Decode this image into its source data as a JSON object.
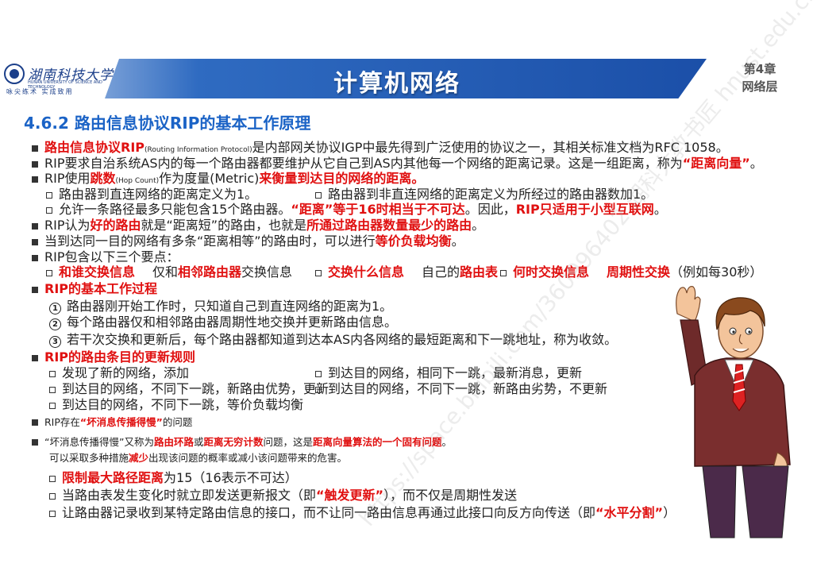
{
  "header": {
    "school_name": "湖南科技大学",
    "school_sub": "HUNAN UNIVERSITY OF SCIENCE AND TECHNOLOGY",
    "motto": "咏尖练术 实成致用",
    "title": "计算机网络",
    "chapter_line1": "第4章",
    "chapter_line2": "网络层"
  },
  "section_title": "4.6.2 路由信息协议RIP的基本工作原理",
  "lines": {
    "l1a": "路由信息协议RIP",
    "l1b": "(Routing Information Protocol)",
    "l1c": "是内部网关协议IGP中最先得到广泛使用的协议之一，其相关标准文档为RFC 1058。",
    "l2a": "RIP要求自治系统AS内的每一个路由器都要维护从它自己到AS内其他每一个网络的距离记录。这是一组距离，称为",
    "l2b": "“距离向量”",
    "l2c": "。",
    "l3a": "RIP使用",
    "l3b": "跳数",
    "l3c": "(Hop Count)",
    "l3d": "作为度量(Metric)",
    "l3e": "来衡量到达目的网络的距离。",
    "l4a": "路由器到直连网络的距离定义为1。",
    "l4b": "路由器到非直连网络的距离定义为所经过的路由器数加1。",
    "l5a": "允许一条路径最多只能包含15个路由器。",
    "l5b": "“距离”等于16时相当于不可达",
    "l5c": "。因此，",
    "l5d": "RIP只适用于小型互联网",
    "l5e": "。",
    "l6a": "RIP认为",
    "l6b": "好的路由",
    "l6c": "就是“距离短”的路由，也就是",
    "l6d": "所通过路由器数量最少的路由",
    "l6e": "。",
    "l7a": "当到达同一目的网络有多条“距离相等”的路由时，可以进行",
    "l7b": "等价负载均衡",
    "l7c": "。",
    "l8": "RIP包含以下三个要点：",
    "l9a": "和谁交换信息",
    "l9b": "仅和",
    "l9c": "相邻路由器",
    "l9d": "交换信息",
    "l9e": "交换什么信息",
    "l9f": "自己的",
    "l9g": "路由表",
    "l9h": "何时交换信息",
    "l9i": "周期性交换",
    "l9j": "（例如每30秒）",
    "l10": "RIP的基本工作过程",
    "n1": "1",
    "n2": "2",
    "n3": "3",
    "s1": "路由器刚开始工作时，只知道自己到直连网络的距离为1。",
    "s2": "每个路由器仅和相邻路由器周期性地交换并更新路由信息。",
    "s3": "若干次交换和更新后，每个路由器都知道到达本AS内各网络的最短距离和下一跳地址，称为收敛。",
    "l11": "RIP的路由条目的更新规则",
    "r1": "发现了新的网络，添加",
    "r2": "到达目的网络，相同下一跳，最新消息，更新",
    "r3": "到达目的网络，不同下一跳，新路由优势，更新",
    "r4": "到达目的网络，不同下一跳，新路由劣势，不更新",
    "r5": "到达目的网络，不同下一跳，等价负载均衡",
    "l12a": "RIP存在",
    "l12b": "“坏消息传播得慢”",
    "l12c": "的问题",
    "l13a": "“坏消息传播得慢”又称为",
    "l13b": "路由环路",
    "l13c": "或",
    "l13d": "距离无穷计数",
    "l13e": "问题，这是",
    "l13f": "距离向量算法的一个固有问题",
    "l13g": "。",
    "l14a": "可以采取多种措施",
    "l14b": "减少",
    "l14c": "出现该问题的概率或减小该问题带来的危害。",
    "m1a": "限制最大路径距离",
    "m1b": "为15（16表示不可达）",
    "m2a": "当路由表发生变化时就立即发送更新报文（即",
    "m2b": "“触发更新”",
    "m2c": "），而不仅是周期性发送",
    "m3a": "让路由器记录收到某特定路由信息的接口，而不让同一路由信息再通过此接口向反方向传送（即",
    "m3b": "“水平分割”",
    "m3c": "）"
  },
  "watermark": "https://space.bilibili.com/360996402  湖科大教书匠  hnust.edu.cn",
  "colors": {
    "accent_blue": "#1b63c6",
    "highlight_red": "#e01010",
    "band_blue": "#1b4fa8"
  }
}
